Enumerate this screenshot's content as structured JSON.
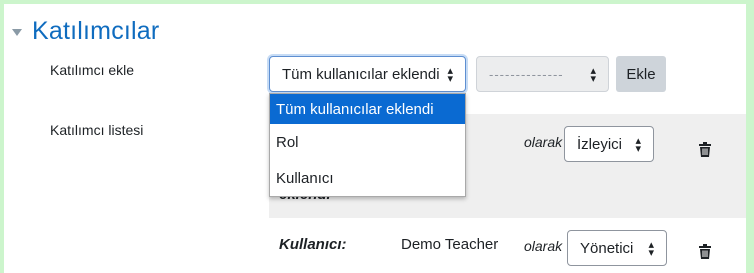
{
  "section": {
    "title": "Katılımcılar"
  },
  "labels": {
    "add_participant": "Katılımcı ekle",
    "participant_list": "Katılımcı listesi"
  },
  "type_select": {
    "value": "Tüm kullanıcılar eklendi"
  },
  "second_select": {
    "value": "--------------"
  },
  "add_button": "Ekle",
  "dropdown": {
    "options": [
      "Tüm kullanıcılar eklendi",
      "Rol",
      "Kullanıcı"
    ],
    "selected_index": 0
  },
  "rows": [
    {
      "type": "eklendi",
      "as_label": "olarak",
      "role": "İzleyici"
    },
    {
      "type": "Kullanıcı:",
      "name": "Demo Teacher",
      "as_label": "olarak",
      "role": "Yönetici"
    }
  ],
  "colors": {
    "title": "#0f6cbf",
    "highlight": "#0a6ad2",
    "row_bg": "#efefef",
    "frame": "#ccf5cc"
  },
  "icons": {
    "collapse": "triangle-down-icon",
    "delete": "trash-icon",
    "select_arrow": "up-down-caret-icon"
  }
}
